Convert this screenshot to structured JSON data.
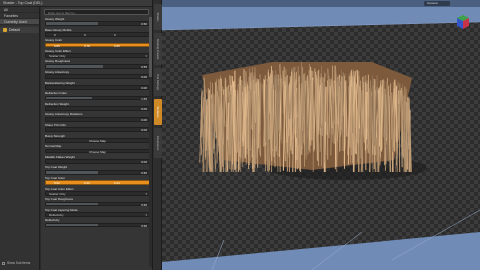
{
  "window": {
    "title": "Shader - Top Coat (DEL)"
  },
  "left_panel": {
    "items": [
      "All",
      "Favorites",
      "Currently Used"
    ],
    "tree_item": "Default"
  },
  "center": {
    "search_placeholder": "Enter text to filter by...",
    "properties": [
      {
        "label": "Glossy Weight",
        "type": "slider",
        "value": "0.50",
        "fill": 0.5
      },
      {
        "label": "Base Glossy Mobile",
        "type": "tristate",
        "left": "0",
        "mid": "0",
        "right": "0"
      },
      {
        "label": "Glossy Color",
        "type": "orange",
        "v1": "0.85",
        "v2": "0.78",
        "v3": "0.65"
      },
      {
        "label": "Glossy Color Effect",
        "type": "dropdown",
        "value": "Scatter Only"
      },
      {
        "label": "Glossy Roughness",
        "type": "slider",
        "value": "0.55",
        "fill": 0.55
      },
      {
        "label": "Glossy Anisotropy",
        "type": "slider",
        "value": "0.00",
        "fill": 0.0
      },
      {
        "label": "Backscattering Weight",
        "type": "slider",
        "value": "0.00",
        "fill": 0.0
      },
      {
        "label": "Refraction Index",
        "type": "slider",
        "value": "1.55",
        "fill": 0.45
      },
      {
        "label": "Refraction Weight",
        "type": "slider",
        "value": "0.00",
        "fill": 0.0
      },
      {
        "label": "Glossy Anisotropy Rotations",
        "type": "slider",
        "value": "0.00",
        "fill": 0.0
      },
      {
        "label": "Share Thin Film",
        "type": "slider",
        "value": "0.00",
        "fill": 0.0
      },
      {
        "label": "Bump Strength",
        "type": "map",
        "value": "Choose Map"
      },
      {
        "label": "Normal Map",
        "type": "map",
        "value": "Choose Map"
      },
      {
        "label": "Metallic Flakes Weight",
        "type": "slider",
        "value": "0.00",
        "fill": 0.0
      },
      {
        "label": "Top Coat Weight",
        "type": "slider",
        "value": "0.50",
        "fill": 0.5
      },
      {
        "label": "Top Coat Color",
        "type": "orange",
        "v1": "0.62",
        "v2": "0.43",
        "v3": "0.24"
      },
      {
        "label": "Top Coat Color Effect",
        "type": "dropdown",
        "value": "Scatter Only"
      },
      {
        "label": "Top Coat Roughness",
        "type": "slider",
        "value": "0.50",
        "fill": 0.5
      },
      {
        "label": "Top Coat Layering Mode",
        "type": "dropdown",
        "value": "Reflectivity"
      },
      {
        "label": "Reflectivity",
        "type": "slider",
        "value": "0.50",
        "fill": 0.5
      }
    ]
  },
  "footer": {
    "label": "Show Sub Items"
  },
  "side_tabs": [
    "Shader",
    "Shading Presets",
    "Tool Settings",
    "Surfaces",
    "Parameters"
  ],
  "viewport": {
    "camera": "Camera"
  },
  "colors": {
    "accent": "#e8901d",
    "viewport_bg": "#6f8bb6",
    "panel": "#353535"
  }
}
